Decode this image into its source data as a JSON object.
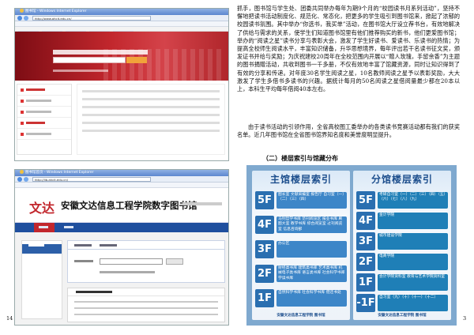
{
  "left_page": {
    "page_number": "14",
    "screenshot_1": {
      "window_title": "图书馆 - Windows Internet Explorer",
      "address": "http://www.ahcit.edu.cn/"
    },
    "screenshot_2": {
      "window_title": "图书馆首页 - Windows Internet Explorer",
      "address": "http://lib.ahcit.edu.cn/",
      "logo": "文达",
      "library_name": "安徽文达信息工程学院数字图书馆"
    }
  },
  "right_page": {
    "page_number": "3",
    "paragraph_1": "抓手，图书馆与学生处、团委共同举办每年为期9个月的“校园读书月系列活动”，坚持不懈地把读书活动制度化、规范化、常态化，把更多的学生吸引到图书馆来，掀起了浓郁的校园读书氛围。其中举办“你选书，我买单”活动，在图书馆大厅设立荐书台，有效地解决了供给与需求的关系，使学生们知道图书馆里有他们推荐购买的新书，他们更爱图书馆；举办的“阅读之星”读书分享与表彰大会，激发了学生好读书、爱读书、乐读书的热情；为提高全校师生阅读水平，丰富知识储备，升华思想境界，每年评出若干名读书征文奖，颁发证书并给与奖励；为庆祝建校20周年在全校范围内开展以“赠人玫瑰，手留余香”为主题的图书捐赠活动，共收到图书一千多册，不仅有效地丰富了馆藏资源，同时让知识得到了有效的分享和传递。对年度30名学生阅读之星，10名教师阅读之星予以表彰奖励，大大激发了学生多借书多读书的兴趣。据统计每月的50名阅读之星借阅量最少都在20本以上，本科生平均每年借阅40本左右。",
    "paragraph_2": "由于读书活动的引领作用，全省高校图工委举办的各类读书竞赛活动都有我们的获奖名单。近几年图书馆在全省图书馆界知名度和美誉度明显提升。",
    "subheading": "（二）楼层索引与馆藏分布",
    "main_sign": {
      "title": "主馆楼层索引",
      "floors": [
        {
          "floor": "5F",
          "text": "图长室  文献采编室  报告厅  自习室（一）（二）（三）（四）"
        },
        {
          "floor": "4F",
          "text": "马列哲学书库  范刊阅览区  报业书库  刷图大室  教学书库  综合阅览室  过刊阅览室  信息咨询部"
        },
        {
          "floor": "3F",
          "text": "办公区"
        },
        {
          "floor": "2F",
          "text": "财经类书库  建筑类书库  艺术类书库  机械电子类书库  语言类书库  社会科学书库  学读书库"
        },
        {
          "floor": "1F",
          "text": "自然科学书库  社会科学书库  借还书处"
        }
      ],
      "footer": "安徽文达信息工程学院  图书馆"
    },
    "branch_sign": {
      "title": "分馆楼层索引",
      "floors": [
        {
          "floor": "5F",
          "text": "考研自习室（一）（二）（三）（四）（五）（六）（七）（八）（九）"
        },
        {
          "floor": "4F",
          "text": "金计学院"
        },
        {
          "floor": "3F",
          "text": "城市建设学院"
        },
        {
          "floor": "2F",
          "text": "电商学院"
        },
        {
          "floor": "1F",
          "text": "会计学院资料室  教育与艺术学院资料室"
        },
        {
          "floor": "-1F",
          "text": "自习室（九）（十）（十一）（十二）"
        }
      ],
      "footer": "安徽文达信息工程学院  图书馆"
    }
  },
  "colors": {
    "banner_red": "#c2272d",
    "nav_blue": "#1f4f9e",
    "sign_background": "#7fa9cf",
    "sign_title": "#1b4d8c"
  }
}
